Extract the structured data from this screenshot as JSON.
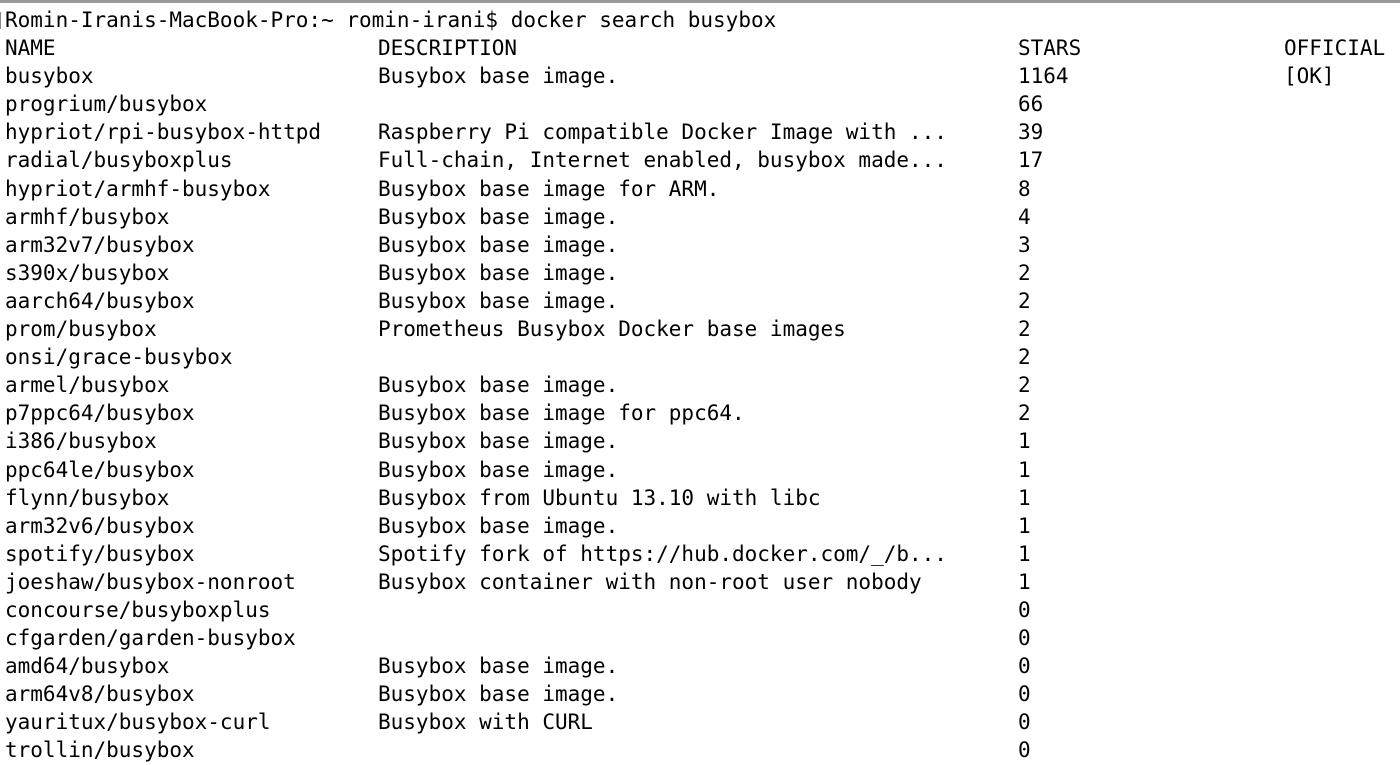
{
  "terminal": {
    "prompt": "Romin-Iranis-MacBook-Pro:~ romin-irani$",
    "command": "docker search busybox"
  },
  "headers": {
    "name": "NAME",
    "description": "DESCRIPTION",
    "stars": "STARS",
    "official": "OFFICIAL"
  },
  "rows": [
    {
      "name": "busybox",
      "description": "Busybox base image.",
      "stars": "1164",
      "official": "[OK]"
    },
    {
      "name": "progrium/busybox",
      "description": "",
      "stars": "66",
      "official": ""
    },
    {
      "name": "hypriot/rpi-busybox-httpd",
      "description": "Raspberry Pi compatible Docker Image with ...",
      "stars": "39",
      "official": ""
    },
    {
      "name": "radial/busyboxplus",
      "description": "Full-chain, Internet enabled, busybox made...",
      "stars": "17",
      "official": ""
    },
    {
      "name": "hypriot/armhf-busybox",
      "description": "Busybox base image for ARM.",
      "stars": "8",
      "official": ""
    },
    {
      "name": "armhf/busybox",
      "description": "Busybox base image.",
      "stars": "4",
      "official": ""
    },
    {
      "name": "arm32v7/busybox",
      "description": "Busybox base image.",
      "stars": "3",
      "official": ""
    },
    {
      "name": "s390x/busybox",
      "description": "Busybox base image.",
      "stars": "2",
      "official": ""
    },
    {
      "name": "aarch64/busybox",
      "description": "Busybox base image.",
      "stars": "2",
      "official": ""
    },
    {
      "name": "prom/busybox",
      "description": "Prometheus Busybox Docker base images",
      "stars": "2",
      "official": ""
    },
    {
      "name": "onsi/grace-busybox",
      "description": "",
      "stars": "2",
      "official": ""
    },
    {
      "name": "armel/busybox",
      "description": "Busybox base image.",
      "stars": "2",
      "official": ""
    },
    {
      "name": "p7ppc64/busybox",
      "description": "Busybox base image for ppc64.",
      "stars": "2",
      "official": ""
    },
    {
      "name": "i386/busybox",
      "description": "Busybox base image.",
      "stars": "1",
      "official": ""
    },
    {
      "name": "ppc64le/busybox",
      "description": "Busybox base image.",
      "stars": "1",
      "official": ""
    },
    {
      "name": "flynn/busybox",
      "description": "Busybox from Ubuntu 13.10 with libc",
      "stars": "1",
      "official": ""
    },
    {
      "name": "arm32v6/busybox",
      "description": "Busybox base image.",
      "stars": "1",
      "official": ""
    },
    {
      "name": "spotify/busybox",
      "description": "Spotify fork of https://hub.docker.com/_/b...",
      "stars": "1",
      "official": ""
    },
    {
      "name": "joeshaw/busybox-nonroot",
      "description": "Busybox container with non-root user nobody",
      "stars": "1",
      "official": ""
    },
    {
      "name": "concourse/busyboxplus",
      "description": "",
      "stars": "0",
      "official": ""
    },
    {
      "name": "cfgarden/garden-busybox",
      "description": "",
      "stars": "0",
      "official": ""
    },
    {
      "name": "amd64/busybox",
      "description": "Busybox base image.",
      "stars": "0",
      "official": ""
    },
    {
      "name": "arm64v8/busybox",
      "description": "Busybox base image.",
      "stars": "0",
      "official": ""
    },
    {
      "name": "yauritux/busybox-curl",
      "description": "Busybox with CURL",
      "stars": "0",
      "official": ""
    },
    {
      "name": "trollin/busybox",
      "description": "",
      "stars": "0",
      "official": ""
    }
  ]
}
